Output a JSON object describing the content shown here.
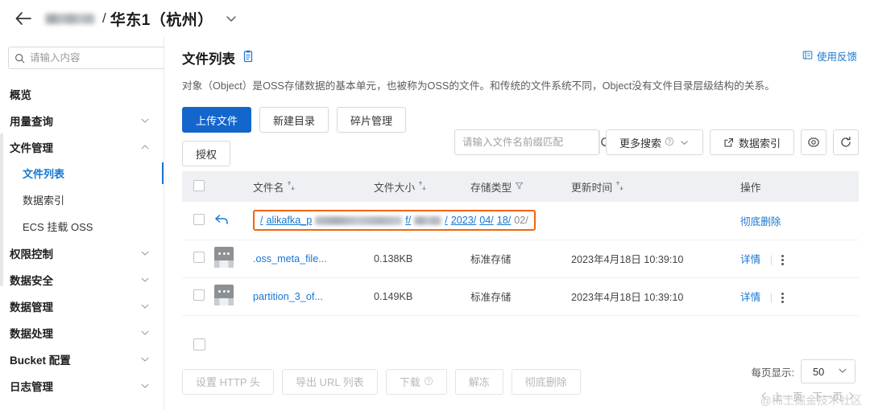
{
  "header": {
    "back_icon": "arrow-left-icon",
    "bucket_name_blurred": "",
    "separator": "/",
    "region": "华东1（杭州）",
    "caret_icon": "chevron-down-icon"
  },
  "sidebar": {
    "search": {
      "placeholder": "请输入内容",
      "value": "",
      "icon": "search-icon"
    },
    "favorite_icon": "star-icon",
    "items": [
      {
        "label": "概览",
        "type": "item",
        "expandable": false
      },
      {
        "label": "用量查询",
        "type": "group",
        "expandable": true,
        "state": "collapsed"
      },
      {
        "label": "文件管理",
        "type": "group",
        "expandable": true,
        "state": "expanded"
      },
      {
        "label": "文件列表",
        "type": "sub",
        "active": true
      },
      {
        "label": "数据索引",
        "type": "sub",
        "active": false
      },
      {
        "label": "ECS 挂载 OSS",
        "type": "sub",
        "active": false
      },
      {
        "label": "权限控制",
        "type": "group",
        "expandable": true,
        "state": "collapsed"
      },
      {
        "label": "数据安全",
        "type": "group",
        "expandable": true,
        "state": "collapsed"
      },
      {
        "label": "数据管理",
        "type": "group",
        "expandable": true,
        "state": "collapsed"
      },
      {
        "label": "数据处理",
        "type": "group",
        "expandable": true,
        "state": "collapsed"
      },
      {
        "label": "Bucket 配置",
        "type": "group",
        "expandable": true,
        "state": "collapsed"
      },
      {
        "label": "日志管理",
        "type": "group",
        "expandable": true,
        "state": "collapsed"
      }
    ]
  },
  "main": {
    "title": "文件列表",
    "title_icon": "clipboard-icon",
    "feedback": {
      "label": "使用反馈",
      "icon": "feedback-icon"
    },
    "description": "对象（Object）是OSS存储数据的基本单元，也被称为OSS的文件。和传统的文件系统不同，Object没有文件目录层级结构的关系。",
    "toolbar": {
      "upload": "上传文件",
      "new_folder": "新建目录",
      "fragment": "碎片管理",
      "authorize": "授权",
      "search_placeholder": "请输入文件名前缀匹配",
      "search_value": "",
      "search_icon": "search-icon",
      "more_search": "更多搜索",
      "more_search_help_icon": "question-circle-icon",
      "more_search_caret": "chevron-down-icon",
      "data_index": "数据索引",
      "data_index_icon": "external-link-icon",
      "settings_icon": "gear-icon",
      "refresh_icon": "refresh-icon"
    },
    "table": {
      "columns": [
        {
          "label": "文件名",
          "sort_icon": "sort-icon"
        },
        {
          "label": "文件大小",
          "sort_icon": "sort-icon"
        },
        {
          "label": "存储类型",
          "filter_icon": "filter-icon"
        },
        {
          "label": "更新时间",
          "sort_icon": "sort-icon"
        },
        {
          "label": "操作"
        }
      ],
      "breadcrumb_row": {
        "back_icon": "return-arrow-icon",
        "highlighted": true,
        "highlight_color": "#f2650a",
        "segments": [
          {
            "text": "/",
            "link": true
          },
          {
            "text": "alikafka_p",
            "link": true,
            "partial_blur": true
          },
          {
            "text": "f/",
            "link": true
          },
          {
            "text": "/",
            "link": true,
            "blurred": true
          },
          {
            "text": "2023/",
            "link": true
          },
          {
            "text": "04/",
            "link": true
          },
          {
            "text": "18/",
            "link": true
          },
          {
            "text": "02/",
            "link": false
          }
        ],
        "action": "彻底删除"
      },
      "rows": [
        {
          "icon": "file-icon",
          "name": ".oss_meta_file...",
          "size": "0.138KB",
          "storage_type": "标准存储",
          "updated": "2023年4月18日 10:39:10",
          "detail": "详情",
          "more_icon": "kebab-menu-icon"
        },
        {
          "icon": "file-icon",
          "name": "partition_3_of...",
          "size": "0.149KB",
          "storage_type": "标准存储",
          "updated": "2023年4月18日 10:39:10",
          "detail": "详情",
          "more_icon": "kebab-menu-icon"
        }
      ]
    },
    "footer": {
      "buttons": [
        {
          "label": "设置 HTTP 头",
          "disabled": true
        },
        {
          "label": "导出 URL 列表",
          "disabled": true
        },
        {
          "label": "下载",
          "disabled": true,
          "help_icon": "question-circle-icon"
        },
        {
          "label": "解冻",
          "disabled": true
        },
        {
          "label": "彻底删除",
          "disabled": true
        }
      ],
      "page_size_label": "每页显示:",
      "page_size_value": "50",
      "prev_page": "上一页",
      "next_page": "下一页",
      "watermark": "@稀土掘金技术社区"
    }
  },
  "colors": {
    "primary": "#1366cc",
    "link": "#1677d2",
    "highlight": "#f2650a",
    "header_bg": "#eef0f3"
  }
}
